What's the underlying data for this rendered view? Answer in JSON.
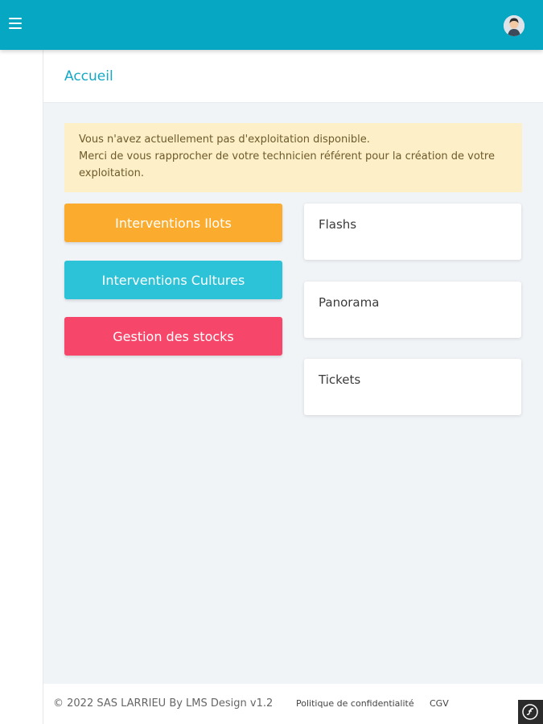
{
  "colors": {
    "topbar": "#05a7c2",
    "title": "#14a8c6",
    "alert_bg": "#fdf0c8",
    "orange": "#fbac2f",
    "cyan": "#2cc3d8",
    "pink": "#f6476a",
    "main_bg": "#f0f4f7"
  },
  "topbar": {
    "menu_icon": "hamburger-menu-icon",
    "avatar_icon": "user-avatar-icon"
  },
  "header": {
    "title": "Accueil"
  },
  "alert": {
    "line1": "Vous n'avez actuellement pas d'exploitation disponible.",
    "line2": "Merci de vous rapprocher de votre technicien référent pour la création de votre exploitation."
  },
  "buttons": [
    {
      "label": "Interventions Ilots",
      "color": "orange"
    },
    {
      "label": "Interventions Cultures",
      "color": "cyan"
    },
    {
      "label": "Gestion des stocks",
      "color": "pink"
    }
  ],
  "cards": [
    {
      "label": "Flashs"
    },
    {
      "label": "Panorama"
    },
    {
      "label": "Tickets"
    }
  ],
  "footer": {
    "copyright": "© 2022 SAS LARRIEU By LMS Design v1.2",
    "privacy": "Politique de confidentialité",
    "cgv": "CGV"
  },
  "corner_badge": {
    "icon": "symfony-debug-icon"
  }
}
